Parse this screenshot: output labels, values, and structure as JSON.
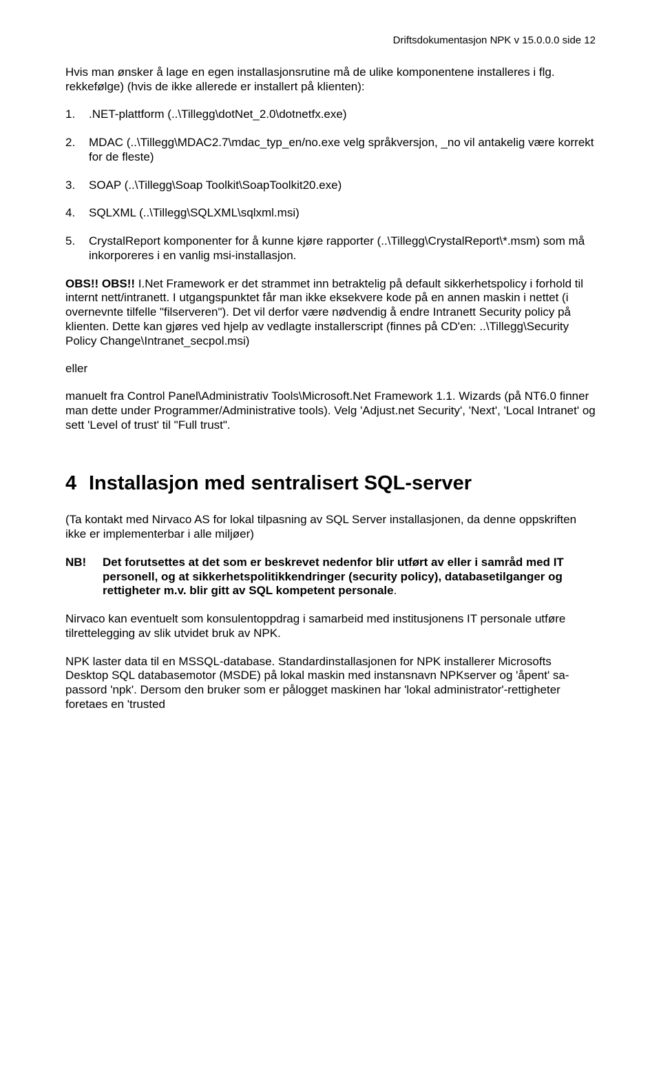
{
  "header": "Driftsdokumentasjon NPK v 15.0.0.0 side 12",
  "intro": "Hvis man ønsker å lage en egen installasjonsrutine må de ulike komponentene installeres i flg. rekkefølge) (hvis de ikke allerede er installert på klienten):",
  "items": [
    {
      "n": "1.",
      "t": ".NET-plattform (..\\Tillegg\\dotNet_2.0\\dotnetfx.exe)"
    },
    {
      "n": "2.",
      "t": "MDAC (..\\Tillegg\\MDAC2.7\\mdac_typ_en/no.exe velg språkversjon, _no vil antakelig være korrekt for de fleste)"
    },
    {
      "n": "3.",
      "t": "SOAP (..\\Tillegg\\Soap Toolkit\\SoapToolkit20.exe)"
    },
    {
      "n": "4.",
      "t": "SQLXML (..\\Tillegg\\SQLXML\\sqlxml.msi)"
    },
    {
      "n": "5.",
      "t": "CrystalReport komponenter for å kunne kjøre rapporter (..\\Tillegg\\CrystalReport\\*.msm) som må inkorporeres i en vanlig msi-installasjon."
    }
  ],
  "obs_bold": "OBS!! OBS!!",
  "obs_rest": " I.Net Framework er det strammet inn betraktelig på default sikkerhetspolicy i forhold til internt nett/intranett. I utgangspunktet får man ikke eksekvere kode på en annen maskin i nettet (i overnevnte tilfelle \"filserveren\"). Det vil derfor være nødvendig å endre Intranett Security policy på klienten. Dette kan gjøres ved hjelp av vedlagte installerscript (finnes på CD'en: ..\\Tillegg\\Security Policy Change\\Intranet_secpol.msi)",
  "eller": "eller",
  "manuelt": "manuelt fra Control Panel\\Administrativ Tools\\Microsoft.Net Framework 1.1. Wizards (på NT6.0 finner man dette under Programmer/Administrative tools). Velg 'Adjust.net Security', 'Next', 'Local Intranet' og sett 'Level of trust' til \"Full trust\".",
  "sect_num": "4",
  "sect_title": "Installasjon med sentralisert SQL-server",
  "sect_p1": "(Ta kontakt med Nirvaco AS for lokal tilpasning av SQL Server installasjonen, da denne oppskriften ikke er implementerbar i alle miljøer)",
  "nb_label": "NB!",
  "nb_body_bold": "Det forutsettes at det som er beskrevet nedenfor blir utført av eller i samråd med IT personell, og at sikkerhetspolitikkendringer (security policy), databasetilganger og rettigheter m.v. blir gitt av SQL kompetent personale",
  "nb_dot": ".",
  "sect_p2": "Nirvaco kan eventuelt som konsulentoppdrag i samarbeid med institusjonens IT personale utføre tilrettelegging av slik utvidet bruk av NPK.",
  "sect_p3": "NPK laster data til en MSSQL-database.  Standardinstallasjonen for NPK installerer Microsofts Desktop SQL databasemotor (MSDE) på lokal maskin med instansnavn NPKserver og 'åpent' sa-passord 'npk'. Dersom den bruker som er pålogget maskinen har 'lokal administrator'-rettigheter foretaes en 'trusted"
}
